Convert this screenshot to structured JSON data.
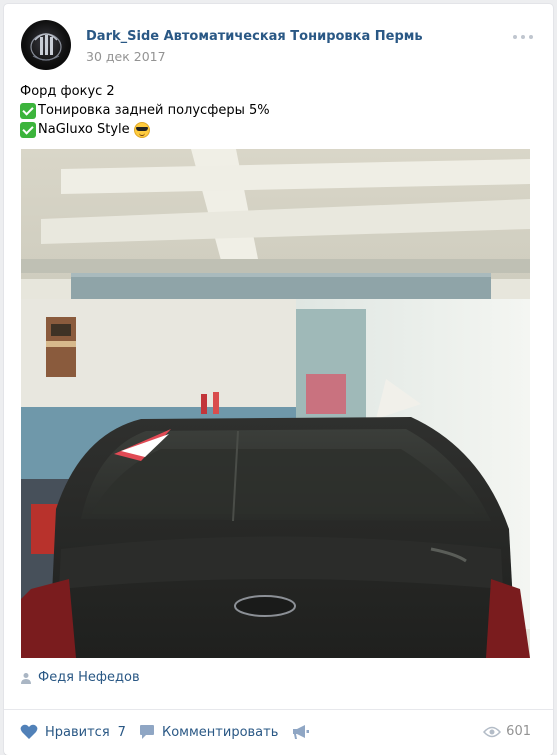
{
  "post": {
    "author": "Dark_Side Автоматическая Тонировка Пермь",
    "date": "30 дек 2017",
    "text_lines": [
      "Форд фокус 2",
      "Тонировка задней полусферы 5%",
      "NaGluxo Style"
    ],
    "signer": "Федя Нефедов"
  },
  "actions": {
    "like_label": "Нравится",
    "like_count": "7",
    "comment_label": "Комментировать",
    "views_count": "601"
  },
  "colors": {
    "link": "#2a5885",
    "muted": "#939393",
    "icon": "#5181b8"
  },
  "icons": [
    "more-icon",
    "check-icon",
    "sunglasses-emoji-icon",
    "person-icon",
    "heart-icon",
    "comment-icon",
    "megaphone-icon",
    "eye-icon"
  ]
}
